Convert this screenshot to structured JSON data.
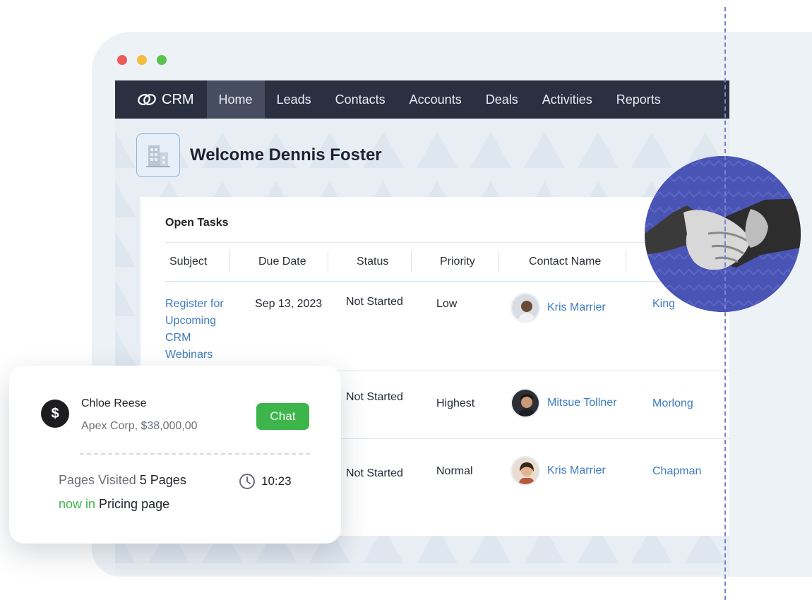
{
  "nav": {
    "brand": "CRM",
    "items": [
      "Home",
      "Leads",
      "Contacts",
      "Accounts",
      "Deals",
      "Activities",
      "Reports"
    ],
    "active": "Home"
  },
  "welcome": {
    "title": "Welcome Dennis Foster"
  },
  "tasks": {
    "title": "Open Tasks",
    "columns": [
      "Subject",
      "Due Date",
      "Status",
      "Priority",
      "Contact Name",
      ""
    ],
    "rows": [
      {
        "subject": "Register for Upcoming CRM Webinars",
        "due": "Sep 13, 2023",
        "status": "Not Started",
        "priority": "Low",
        "contact": "Kris Marrier",
        "account": "King"
      },
      {
        "subject": "",
        "due": "",
        "status": "Not Started",
        "priority": "Highest",
        "contact": "Mitsue Tollner",
        "account": "Morlong"
      },
      {
        "subject": "",
        "due": "",
        "status": "Not Started",
        "priority": "Normal",
        "contact": "Kris Marrier",
        "account": "Chapman"
      }
    ]
  },
  "chat_card": {
    "icon": "dollar-icon",
    "name": "Chloe Reese",
    "company": "Apex Corp, $38,000,00",
    "chat_label": "Chat",
    "pages_label": "Pages Visited",
    "pages_value": "5 Pages",
    "time": "10:23",
    "now_in_label": "now in",
    "now_in_value": "Pricing page"
  },
  "colors": {
    "nav_bg": "#2a3040",
    "link": "#3f7bc1",
    "chat_green": "#3db54a",
    "circle_blue": "#4a54b4"
  }
}
